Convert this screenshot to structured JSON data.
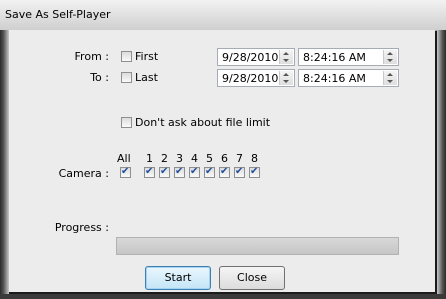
{
  "window": {
    "title": "Save As Self-Player"
  },
  "from": {
    "label": "From :",
    "checkbox_label": "First",
    "checked": false,
    "date": "9/28/2010",
    "time": "8:24:16 AM"
  },
  "to": {
    "label": "To :",
    "checkbox_label": "Last",
    "checked": false,
    "date": "9/28/2010",
    "time": "8:24:16 AM"
  },
  "file_limit": {
    "label": "Don't ask about file limit",
    "checked": false
  },
  "camera": {
    "label": "Camera :",
    "all_label": "All",
    "all_checked": true,
    "numbers": [
      "1",
      "2",
      "3",
      "4",
      "5",
      "6",
      "7",
      "8"
    ],
    "checked": [
      true,
      true,
      true,
      true,
      true,
      true,
      true,
      true
    ]
  },
  "progress": {
    "label": "Progress :",
    "value": 0
  },
  "buttons": {
    "start": "Start",
    "close": "Close"
  }
}
